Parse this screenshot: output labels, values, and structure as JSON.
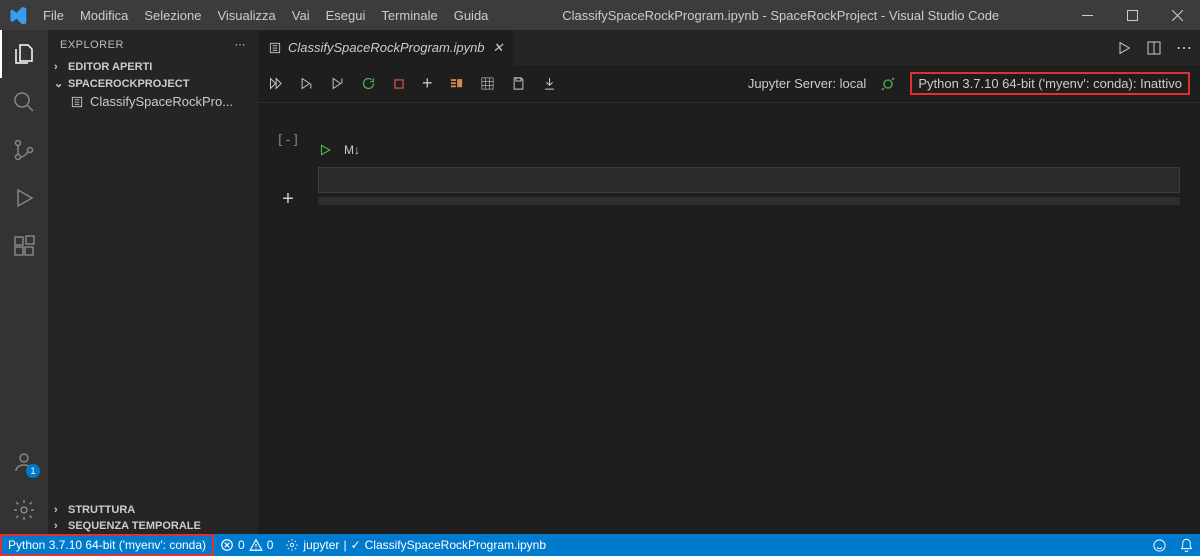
{
  "menu": [
    "File",
    "Modifica",
    "Selezione",
    "Visualizza",
    "Vai",
    "Esegui",
    "Terminale",
    "Guida"
  ],
  "window_title": "ClassifySpaceRockProgram.ipynb - SpaceRockProject - Visual Studio Code",
  "explorer": {
    "title": "EXPLORER",
    "editors_open": "EDITOR APERTI",
    "project": "SPACEROCKPROJECT",
    "file": "ClassifySpaceRockPro...",
    "structure": "STRUTTURA",
    "timeline": "SEQUENZA TEMPORALE"
  },
  "tab": {
    "name": "ClassifySpaceRockProgram.ipynb"
  },
  "notebook": {
    "jupyter_server": "Jupyter Server: local",
    "kernel": "Python 3.7.10 64-bit ('myenv': conda): Inattivo",
    "cell_prompt": "[-]",
    "markdown": "M↓"
  },
  "status": {
    "python": "Python 3.7.10 64-bit ('myenv': conda)",
    "errors": "0",
    "warnings": "0",
    "jupyter": "jupyter",
    "file": "ClassifySpaceRockProgram.ipynb"
  },
  "accounts_badge": "1"
}
